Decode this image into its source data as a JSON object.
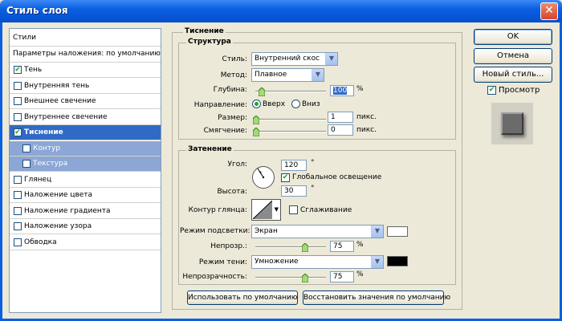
{
  "window": {
    "title": "Стиль слоя"
  },
  "sidebar": {
    "styles_header": "Стили",
    "blend_defaults": "Параметры наложения: по умолчанию",
    "items": [
      {
        "label": "Тень",
        "checked": true,
        "state": "normal"
      },
      {
        "label": "Внутренняя тень",
        "checked": false,
        "state": "normal"
      },
      {
        "label": "Внешнее свечение",
        "checked": false,
        "state": "normal"
      },
      {
        "label": "Внутреннее свечение",
        "checked": false,
        "state": "normal"
      },
      {
        "label": "Тиснение",
        "checked": true,
        "state": "selected"
      },
      {
        "label": "Контур",
        "checked": false,
        "state": "sub"
      },
      {
        "label": "Текстура",
        "checked": false,
        "state": "sub"
      },
      {
        "label": "Глянец",
        "checked": false,
        "state": "normal"
      },
      {
        "label": "Наложение цвета",
        "checked": false,
        "state": "normal"
      },
      {
        "label": "Наложение градиента",
        "checked": false,
        "state": "normal"
      },
      {
        "label": "Наложение узора",
        "checked": false,
        "state": "normal"
      },
      {
        "label": "Обводка",
        "checked": false,
        "state": "normal"
      }
    ]
  },
  "emboss": {
    "title": "Тиснение",
    "structure": {
      "title": "Структура",
      "style_label": "Стиль:",
      "style_value": "Внутренний скос",
      "method_label": "Метод:",
      "method_value": "Плавное",
      "depth_label": "Глубина:",
      "depth_value": "100",
      "depth_unit": "%",
      "direction_label": "Направление:",
      "dir_up": "Вверх",
      "dir_down": "Вниз",
      "direction_selected": "up",
      "size_label": "Размер:",
      "size_value": "1",
      "size_unit": "пикс.",
      "soften_label": "Смягчение:",
      "soften_value": "0",
      "soften_unit": "пикс."
    },
    "shading": {
      "title": "Затенение",
      "angle_label": "Угол:",
      "angle_value": "120",
      "angle_unit": "°",
      "global_light_label": "Глобальное освещение",
      "global_light_checked": true,
      "altitude_label": "Высота:",
      "altitude_value": "30",
      "altitude_unit": "°",
      "gloss_contour_label": "Контур глянца:",
      "antialias_label": "Сглаживание",
      "antialias_checked": false,
      "highlight_mode_label": "Режим подсветки:",
      "highlight_mode_value": "Экран",
      "highlight_color": "#ffffff",
      "highlight_opacity_label": "Непрозр.:",
      "highlight_opacity_value": "75",
      "highlight_opacity_unit": "%",
      "shadow_mode_label": "Режим тени:",
      "shadow_mode_value": "Умножение",
      "shadow_color": "#000000",
      "shadow_opacity_label": "Непрозрачность:",
      "shadow_opacity_value": "75",
      "shadow_opacity_unit": "%"
    },
    "make_default_button": "Использовать по умолчанию",
    "reset_default_button": "Восстановить значения по умолчанию"
  },
  "actions": {
    "ok": "OK",
    "cancel": "Отмена",
    "new_style": "Новый стиль...",
    "preview_label": "Просмотр",
    "preview_checked": true
  },
  "colors": {
    "title_bar": "#0a5fe0",
    "selection": "#316ac5",
    "sub_item": "#8ca6d6",
    "dialog_bg": "#ece9d8"
  }
}
